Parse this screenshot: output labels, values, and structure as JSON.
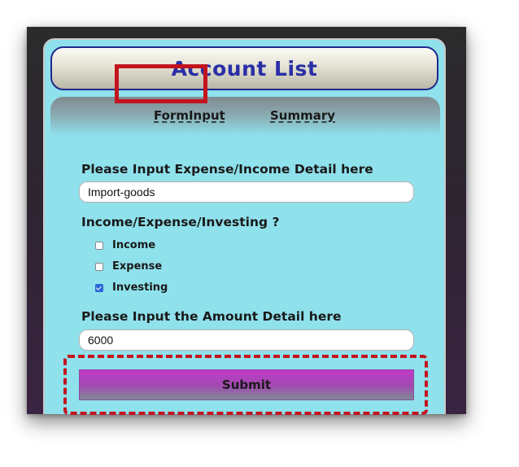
{
  "app": {
    "title": "Account List"
  },
  "tabs": [
    {
      "label": "FormInput",
      "active": true
    },
    {
      "label": "Summary",
      "active": false
    }
  ],
  "form": {
    "detail_label": "Please Input Expense/Income Detail here",
    "detail_value": "Import-goods",
    "type_label": "Income/Expense/Investing ?",
    "options": [
      {
        "label": "Income",
        "checked": false
      },
      {
        "label": "Expense",
        "checked": false
      },
      {
        "label": "Investing",
        "checked": true
      }
    ],
    "amount_label": "Please Input the Amount Detail here",
    "amount_value": "6000",
    "submit_label": "Submit"
  },
  "colors": {
    "highlight": "#c3141e",
    "title_text": "#2a2fa6",
    "panel_background": "#8fe1ec",
    "submit_gradient_top": "#c03ac8"
  }
}
